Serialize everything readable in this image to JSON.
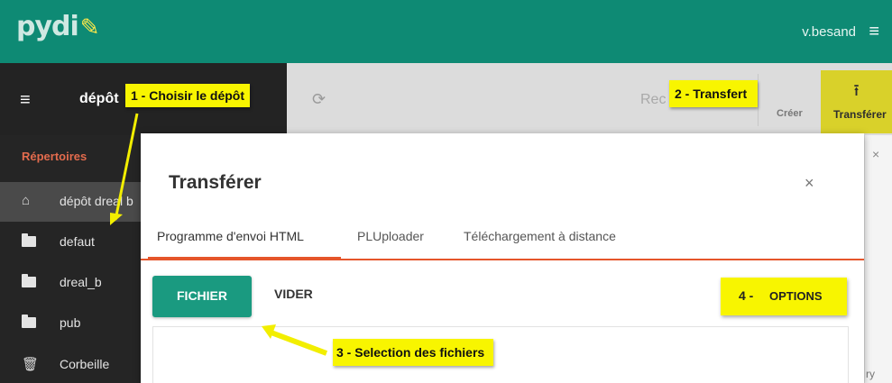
{
  "app": {
    "logo_text": "pydi",
    "logo_mark": "✎",
    "user": "v.besand"
  },
  "nav": {
    "depot_label": "dépôt"
  },
  "toolbar": {
    "rec_partial": "Rec",
    "creer_partial": "Créer",
    "transferer_label": "Transférer"
  },
  "sidebar": {
    "header": "Répertoires",
    "items": [
      {
        "label": "dépôt dreal b",
        "icon": "home-icon"
      },
      {
        "label": "defaut",
        "icon": "folder-icon"
      },
      {
        "label": "dreal_b",
        "icon": "folder-icon"
      },
      {
        "label": "pub",
        "icon": "folder-icon"
      },
      {
        "label": "Corbeille",
        "icon": "trash-icon"
      }
    ]
  },
  "modal": {
    "title": "Transférer",
    "close": "×",
    "tabs": [
      {
        "label": "Programme d'envoi HTML",
        "active": true
      },
      {
        "label": "PLUploader",
        "active": false
      },
      {
        "label": "Téléchargement à distance",
        "active": false
      }
    ],
    "fichier_label": "FICHIER",
    "vider_label": "VIDER",
    "options_number": "4 -",
    "options_label": "OPTIONS"
  },
  "backdrop": {
    "close": "×",
    "partial_text": "ry"
  },
  "annotations": {
    "choose_depot": "1 - Choisir le dépôt",
    "transfer": "2 - Transfert",
    "select_files": "3 - Selection des fichiers"
  },
  "colors": {
    "brand": "#0e8a74",
    "accent": "#e5552b",
    "highlight": "#f8f500",
    "button": "#1a9a80"
  }
}
